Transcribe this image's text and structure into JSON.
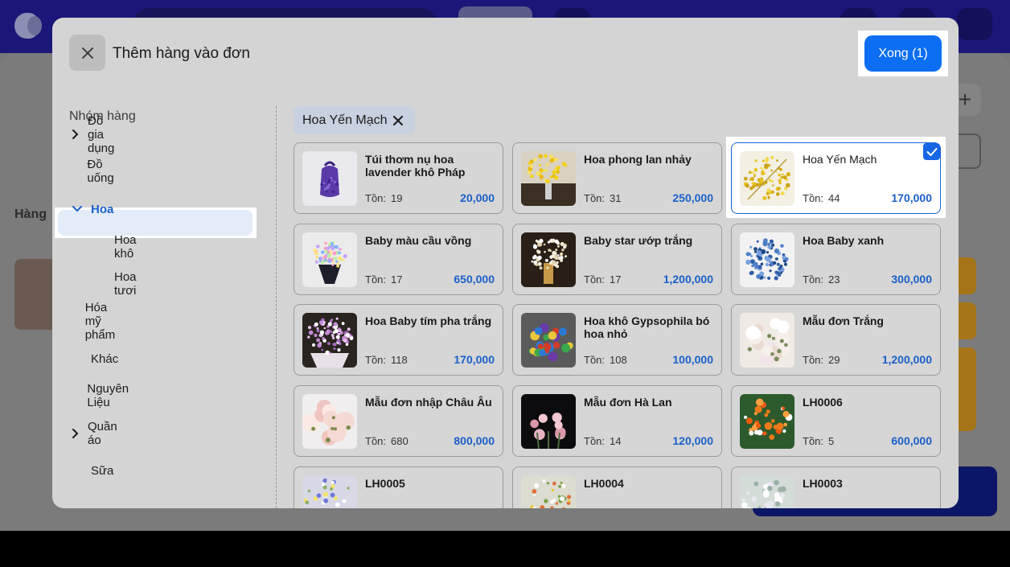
{
  "modal": {
    "title": "Thêm hàng vào đơn",
    "done_label": "Xong (1)"
  },
  "sidebar": {
    "heading": "Nhóm hàng",
    "items": [
      {
        "label": "Đồ gia dụng",
        "expandable": true,
        "expanded": false,
        "level": 0
      },
      {
        "label": "Đồ uống",
        "expandable": false,
        "level": 0
      },
      {
        "label": "Hoa",
        "expandable": true,
        "expanded": true,
        "active": true,
        "level": 0
      },
      {
        "label": "Hoa khô",
        "expandable": false,
        "level": 1
      },
      {
        "label": "Hoa tươi",
        "expandable": false,
        "level": 1
      },
      {
        "label": "Hóa mỹ phẩm",
        "expandable": false,
        "level": 0
      },
      {
        "label": "Khác",
        "expandable": false,
        "level": 0
      },
      {
        "label": "Nguyên Liệu",
        "expandable": false,
        "level": 0
      },
      {
        "label": "Quần áo",
        "expandable": true,
        "expanded": false,
        "level": 0
      },
      {
        "label": "Sữa",
        "expandable": false,
        "level": 0
      }
    ]
  },
  "filter_chip": {
    "label": "Hoa Yến Mạch"
  },
  "stock_label": "Tồn:",
  "products": [
    {
      "name": "Túi thơm nụ hoa lavender khô Pháp",
      "stock": "19",
      "price": "20,000",
      "image": "lavender-bag",
      "selected": false
    },
    {
      "name": "Hoa phong lan nhảy",
      "stock": "31",
      "price": "250,000",
      "image": "yellow-orchid",
      "selected": false
    },
    {
      "name": "Hoa Yến Mạch",
      "stock": "44",
      "price": "170,000",
      "image": "oat-flower",
      "selected": true
    },
    {
      "name": "Baby màu cầu vồng",
      "stock": "17",
      "price": "650,000",
      "image": "rainbow-baby",
      "selected": false
    },
    {
      "name": "Baby star ướp trắng",
      "stock": "17",
      "price": "1,200,000",
      "image": "white-star",
      "selected": false
    },
    {
      "name": "Hoa Baby xanh",
      "stock": "23",
      "price": "300,000",
      "image": "blue-baby",
      "selected": false
    },
    {
      "name": "Hoa Baby tím pha trắng",
      "stock": "118",
      "price": "170,000",
      "image": "purple-baby",
      "selected": false
    },
    {
      "name": "Hoa khô Gypsophila bó hoa nhỏ",
      "stock": "108",
      "price": "100,000",
      "image": "gypsophila",
      "selected": false
    },
    {
      "name": "Mẫu đơn Trắng",
      "stock": "29",
      "price": "1,200,000",
      "image": "white-peony",
      "selected": false
    },
    {
      "name": "Mẫu đơn nhập Châu Âu",
      "stock": "680",
      "price": "800,000",
      "image": "eu-peony",
      "selected": false
    },
    {
      "name": "Mẫu đơn Hà Lan",
      "stock": "14",
      "price": "120,000",
      "image": "dutch-peony",
      "selected": false
    },
    {
      "name": "LH0006",
      "stock": "5",
      "price": "600,000",
      "image": "orange-basket",
      "selected": false
    },
    {
      "name": "LH0005",
      "stock": "",
      "price": "",
      "image": "mixed-1",
      "selected": false
    },
    {
      "name": "LH0004",
      "stock": "",
      "price": "",
      "image": "mixed-2",
      "selected": false
    },
    {
      "name": "LH0003",
      "stock": "",
      "price": "",
      "image": "mixed-3",
      "selected": false
    }
  ],
  "colors": {
    "accent": "#0b6ef3",
    "price": "#1b5fc8",
    "active_bg": "#e3ecf8",
    "chip_bg": "#c7d1e0"
  }
}
